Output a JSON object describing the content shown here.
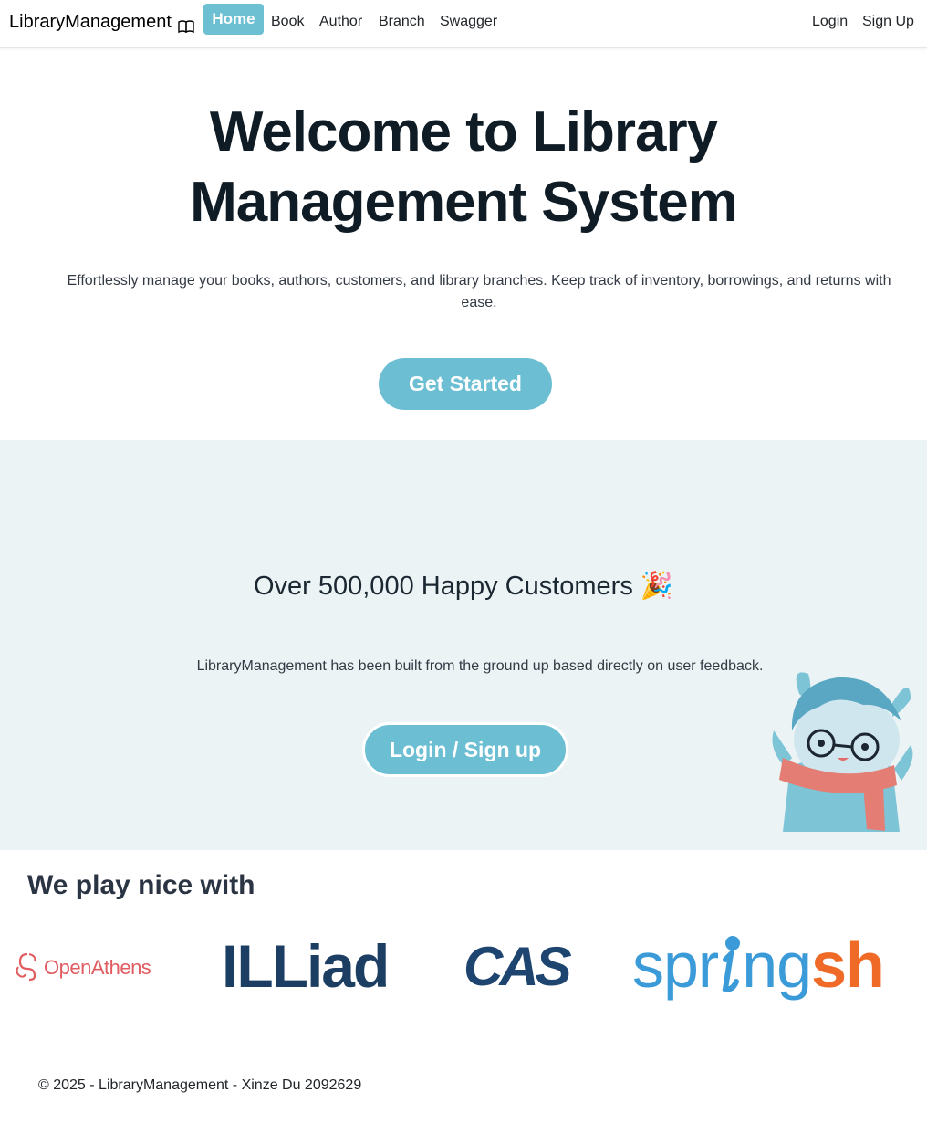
{
  "nav": {
    "brand": "LibraryManagement",
    "brand_icon": "book-open-icon",
    "links": [
      "Home",
      "Book",
      "Author",
      "Branch",
      "Swagger"
    ],
    "active": "Home",
    "login": "Login",
    "signup": "Sign Up"
  },
  "hero": {
    "title_line1": "Welcome to Library",
    "title_line2": "Management System",
    "subtitle": "Effortlessly manage your books, authors, customers, and library branches. Keep track of inventory, borrowings, and returns with ease.",
    "cta": "Get Started"
  },
  "customers": {
    "title": "Over 500,000 Happy Customers",
    "emoji": "🎉",
    "subtitle": "LibraryManagement has been built from the ground up based directly on user feedback.",
    "cta": "Login / Sign up",
    "mascot_icon": "mascot-illustration"
  },
  "partners": {
    "title": "We play nice with",
    "logos": {
      "openathens": "OpenAthens",
      "illiad": "ILLiad",
      "cas": "CAS",
      "spring_a": "spr",
      "spring_b": "ngsh"
    }
  },
  "footer": {
    "text": "© 2025 - LibraryManagement - Xinze Du 2092629"
  },
  "colors": {
    "accent": "#6cbfd3",
    "section_bg": "#ebf3f5",
    "heading": "#0f1c26"
  }
}
